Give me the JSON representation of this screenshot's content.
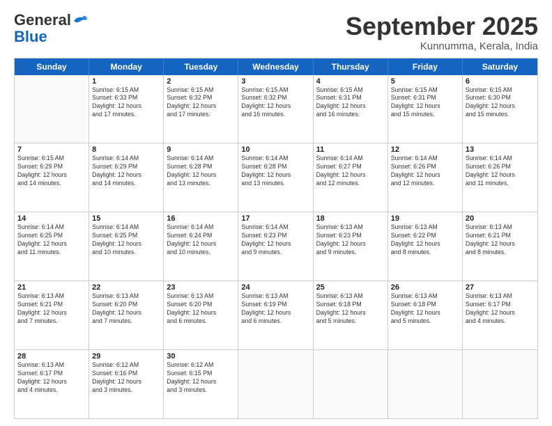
{
  "header": {
    "logo_line1": "General",
    "logo_line2": "Blue",
    "month_title": "September 2025",
    "location": "Kunnumma, Kerala, India"
  },
  "days_of_week": [
    "Sunday",
    "Monday",
    "Tuesday",
    "Wednesday",
    "Thursday",
    "Friday",
    "Saturday"
  ],
  "weeks": [
    [
      {
        "day": "",
        "info": ""
      },
      {
        "day": "1",
        "info": "Sunrise: 6:15 AM\nSunset: 6:33 PM\nDaylight: 12 hours\nand 17 minutes."
      },
      {
        "day": "2",
        "info": "Sunrise: 6:15 AM\nSunset: 6:32 PM\nDaylight: 12 hours\nand 17 minutes."
      },
      {
        "day": "3",
        "info": "Sunrise: 6:15 AM\nSunset: 6:32 PM\nDaylight: 12 hours\nand 16 minutes."
      },
      {
        "day": "4",
        "info": "Sunrise: 6:15 AM\nSunset: 6:31 PM\nDaylight: 12 hours\nand 16 minutes."
      },
      {
        "day": "5",
        "info": "Sunrise: 6:15 AM\nSunset: 6:31 PM\nDaylight: 12 hours\nand 15 minutes."
      },
      {
        "day": "6",
        "info": "Sunrise: 6:15 AM\nSunset: 6:30 PM\nDaylight: 12 hours\nand 15 minutes."
      }
    ],
    [
      {
        "day": "7",
        "info": "Sunrise: 6:15 AM\nSunset: 6:29 PM\nDaylight: 12 hours\nand 14 minutes."
      },
      {
        "day": "8",
        "info": "Sunrise: 6:14 AM\nSunset: 6:29 PM\nDaylight: 12 hours\nand 14 minutes."
      },
      {
        "day": "9",
        "info": "Sunrise: 6:14 AM\nSunset: 6:28 PM\nDaylight: 12 hours\nand 13 minutes."
      },
      {
        "day": "10",
        "info": "Sunrise: 6:14 AM\nSunset: 6:28 PM\nDaylight: 12 hours\nand 13 minutes."
      },
      {
        "day": "11",
        "info": "Sunrise: 6:14 AM\nSunset: 6:27 PM\nDaylight: 12 hours\nand 12 minutes."
      },
      {
        "day": "12",
        "info": "Sunrise: 6:14 AM\nSunset: 6:26 PM\nDaylight: 12 hours\nand 12 minutes."
      },
      {
        "day": "13",
        "info": "Sunrise: 6:14 AM\nSunset: 6:26 PM\nDaylight: 12 hours\nand 11 minutes."
      }
    ],
    [
      {
        "day": "14",
        "info": "Sunrise: 6:14 AM\nSunset: 6:25 PM\nDaylight: 12 hours\nand 11 minutes."
      },
      {
        "day": "15",
        "info": "Sunrise: 6:14 AM\nSunset: 6:25 PM\nDaylight: 12 hours\nand 10 minutes."
      },
      {
        "day": "16",
        "info": "Sunrise: 6:14 AM\nSunset: 6:24 PM\nDaylight: 12 hours\nand 10 minutes."
      },
      {
        "day": "17",
        "info": "Sunrise: 6:14 AM\nSunset: 6:23 PM\nDaylight: 12 hours\nand 9 minutes."
      },
      {
        "day": "18",
        "info": "Sunrise: 6:13 AM\nSunset: 6:23 PM\nDaylight: 12 hours\nand 9 minutes."
      },
      {
        "day": "19",
        "info": "Sunrise: 6:13 AM\nSunset: 6:22 PM\nDaylight: 12 hours\nand 8 minutes."
      },
      {
        "day": "20",
        "info": "Sunrise: 6:13 AM\nSunset: 6:21 PM\nDaylight: 12 hours\nand 8 minutes."
      }
    ],
    [
      {
        "day": "21",
        "info": "Sunrise: 6:13 AM\nSunset: 6:21 PM\nDaylight: 12 hours\nand 7 minutes."
      },
      {
        "day": "22",
        "info": "Sunrise: 6:13 AM\nSunset: 6:20 PM\nDaylight: 12 hours\nand 7 minutes."
      },
      {
        "day": "23",
        "info": "Sunrise: 6:13 AM\nSunset: 6:20 PM\nDaylight: 12 hours\nand 6 minutes."
      },
      {
        "day": "24",
        "info": "Sunrise: 6:13 AM\nSunset: 6:19 PM\nDaylight: 12 hours\nand 6 minutes."
      },
      {
        "day": "25",
        "info": "Sunrise: 6:13 AM\nSunset: 6:18 PM\nDaylight: 12 hours\nand 5 minutes."
      },
      {
        "day": "26",
        "info": "Sunrise: 6:13 AM\nSunset: 6:18 PM\nDaylight: 12 hours\nand 5 minutes."
      },
      {
        "day": "27",
        "info": "Sunrise: 6:13 AM\nSunset: 6:17 PM\nDaylight: 12 hours\nand 4 minutes."
      }
    ],
    [
      {
        "day": "28",
        "info": "Sunrise: 6:13 AM\nSunset: 6:17 PM\nDaylight: 12 hours\nand 4 minutes."
      },
      {
        "day": "29",
        "info": "Sunrise: 6:12 AM\nSunset: 6:16 PM\nDaylight: 12 hours\nand 3 minutes."
      },
      {
        "day": "30",
        "info": "Sunrise: 6:12 AM\nSunset: 6:15 PM\nDaylight: 12 hours\nand 3 minutes."
      },
      {
        "day": "",
        "info": ""
      },
      {
        "day": "",
        "info": ""
      },
      {
        "day": "",
        "info": ""
      },
      {
        "day": "",
        "info": ""
      }
    ]
  ]
}
